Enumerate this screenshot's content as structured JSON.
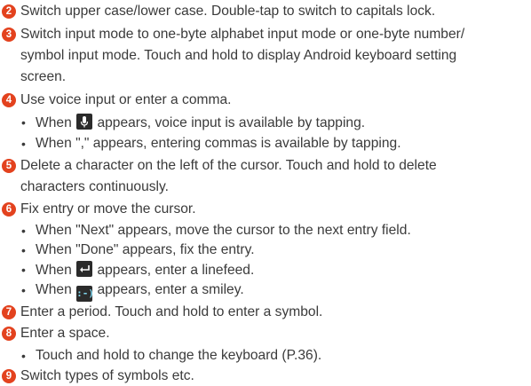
{
  "accent": "#e3421e",
  "items": [
    {
      "number": "2",
      "text": "Switch upper case/lower case. Double-tap to switch to capitals lock."
    },
    {
      "number": "3",
      "lines": [
        "Switch input mode to one-byte alphabet input mode or one-byte number/",
        "symbol input mode. Touch and hold to display Android keyboard setting",
        "screen."
      ]
    },
    {
      "number": "4",
      "text": "Use voice input or enter a comma.",
      "bullets": [
        {
          "before": "When",
          "icon": "microphone-icon",
          "after": "appears, voice input is available by tapping."
        },
        {
          "text": "When \",\" appears, entering commas is available by tapping."
        }
      ]
    },
    {
      "number": "5",
      "lines": [
        "Delete a character on the left of the cursor. Touch and hold to delete",
        "characters continuously."
      ]
    },
    {
      "number": "6",
      "text": "Fix entry or move the cursor.",
      "bullets": [
        {
          "text": "When \"Next\" appears, move the cursor to the next entry field."
        },
        {
          "text": "When \"Done\" appears, fix the entry."
        },
        {
          "before": "When",
          "icon": "enter-arrow-icon",
          "after": "appears, enter a linefeed."
        },
        {
          "before": "When",
          "icon": "smiley-icon",
          "icon_text": ":-)",
          "after": "appears, enter a smiley."
        }
      ]
    },
    {
      "number": "7",
      "text": "Enter a period. Touch and hold to enter a symbol."
    },
    {
      "number": "8",
      "text": "Enter a space.",
      "bullets": [
        {
          "text": "Touch and hold to change the keyboard (P.36)."
        }
      ]
    },
    {
      "number": "9",
      "text": "Switch types of symbols etc."
    }
  ]
}
